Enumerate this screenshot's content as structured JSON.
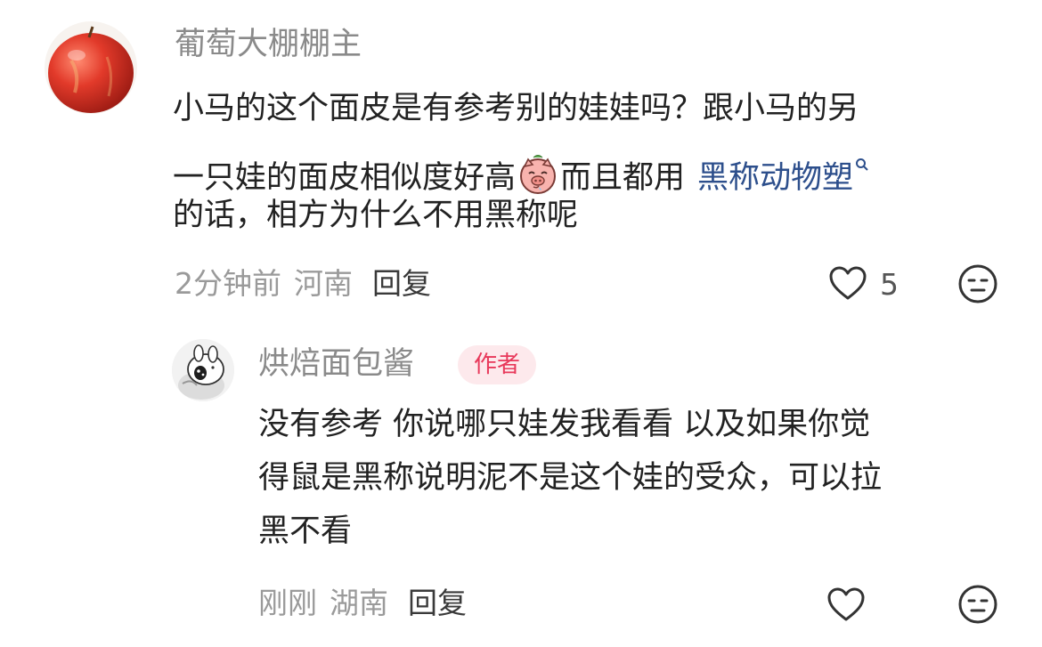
{
  "comment": {
    "username": "葡萄大棚棚主",
    "text_lines": [
      "小马的这个面皮是有参考别的娃娃吗？跟小马的另",
      "一只娃的面皮相似度好高",
      "而且都用",
      "的话，相方为什么不用黑称呢"
    ],
    "topic_link": "黑称动物塑",
    "time": "2分钟前",
    "location": "河南",
    "reply_label": "回复",
    "like_count": "5",
    "emoji_name": "pig-drool-emoji"
  },
  "reply": {
    "username": "烘焙面包酱",
    "badge": "作者",
    "text_lines": [
      "没有参考 你说哪只娃发我看看 以及如果你觉",
      "得鼠是黑称说明泥不是这个娃的受众，可以拉",
      "黑不看"
    ],
    "time": "刚刚",
    "location": "湖南",
    "reply_label": "回复"
  },
  "colors": {
    "username": "#8a8a8a",
    "topic_link": "#2d4f8c",
    "badge_text": "#e8385a",
    "badge_bg": "#fde9ec"
  }
}
